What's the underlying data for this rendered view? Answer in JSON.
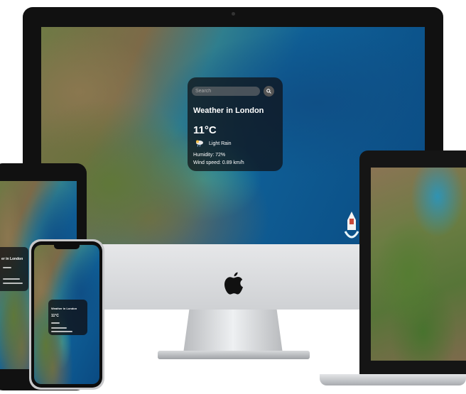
{
  "weather_app": {
    "search_placeholder": "Search",
    "title": "Weather in London",
    "temperature": "11°C",
    "description": "Light Rain",
    "humidity": "Humidity: 72%",
    "wind_speed": "Wind speed: 0.89 km/h",
    "weather_icon": "rain-cloud-icon",
    "search_icon": "search-icon"
  },
  "devices": {
    "phone_title": "Weather in London",
    "phone_temperature": "11°C",
    "tablet_title": "er in London"
  },
  "colors": {
    "card_background": "#0f0f14",
    "imac_bezel": "#111111",
    "imac_chin": "#dcdddf"
  }
}
